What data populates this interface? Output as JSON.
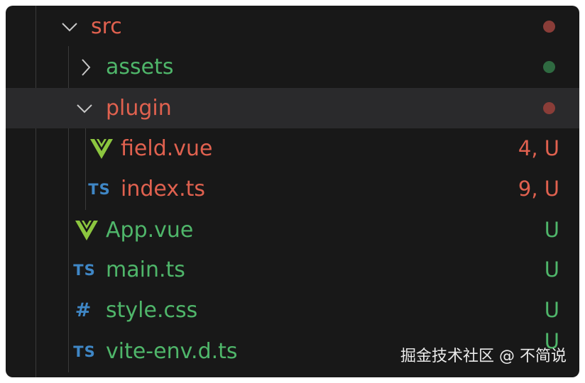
{
  "tree": {
    "src": {
      "label": "src",
      "color": "#e0614f",
      "dot_color": "#8a3d38",
      "icon": "chevron-down-icon"
    },
    "assets": {
      "label": "assets",
      "color": "#4fb66a",
      "dot_color": "#2f6a41",
      "icon": "chevron-right-icon"
    },
    "plugin": {
      "label": "plugin",
      "color": "#e0614f",
      "dot_color": "#8a3d38",
      "icon": "chevron-down-icon"
    },
    "field_vue": {
      "label": "field.vue",
      "status": "4, U",
      "icon": "vue-icon"
    },
    "index_ts": {
      "label": "index.ts",
      "status": "9, U",
      "icon_text": "TS"
    },
    "app_vue": {
      "label": "App.vue",
      "status": "U",
      "icon": "vue-icon"
    },
    "main_ts": {
      "label": "main.ts",
      "status": "U",
      "icon_text": "TS"
    },
    "style_css": {
      "label": "style.css",
      "status": "U",
      "icon_text": "#"
    },
    "vite_env": {
      "label": "vite-env.d.ts",
      "status": "U",
      "icon_text": "TS"
    }
  },
  "colors": {
    "modified_red": "#e0614f",
    "untracked_green": "#4fb66a",
    "typescript_blue": "#3f87c6",
    "vue_green": "#8cc63f",
    "panel_bg": "#181818",
    "selected_row_bg": "#2a2a2c"
  },
  "watermark": "掘金技术社区 @ 不简说"
}
